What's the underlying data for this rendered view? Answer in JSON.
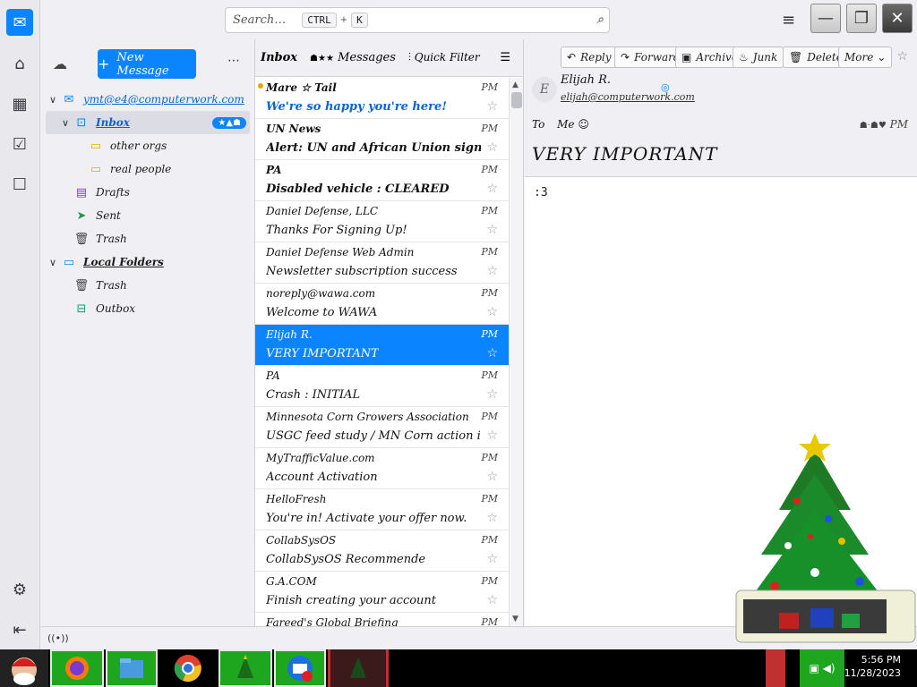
{
  "search": {
    "placeholder": "Search…",
    "kbd1": "CTRL",
    "kbd2": "K"
  },
  "folder_pane": {
    "new_message": "New Message",
    "account": "ymt@e4@computerwork.com",
    "badge": "",
    "folders": [
      {
        "label": "Inbox"
      },
      {
        "label": "other orgs"
      },
      {
        "label": "real people"
      },
      {
        "label": "Drafts"
      },
      {
        "label": "Sent"
      },
      {
        "label": "Trash"
      },
      {
        "label": "Local Folders"
      },
      {
        "label": "Trash"
      },
      {
        "label": "Outbox"
      }
    ]
  },
  "list": {
    "title": "Inbox",
    "count": "Messages",
    "quick_filter": "Quick Filter",
    "messages": [
      {
        "sender": "Mare ☆ Tail",
        "subject": "We're so happy you're here!",
        "time": "PM",
        "unread": true
      },
      {
        "sender": "UN News",
        "subject": "Alert: UN and African Union sign new hi...",
        "time": "PM",
        "unread": true
      },
      {
        "sender": "PA",
        "subject": "Disabled vehicle : CLEARED",
        "time": "PM",
        "unread": true
      },
      {
        "sender": "Daniel Defense, LLC",
        "subject": "Thanks For Signing Up!",
        "time": "PM",
        "unread": false
      },
      {
        "sender": "Daniel Defense Web Admin",
        "subject": "Newsletter subscription success",
        "time": "PM",
        "unread": false
      },
      {
        "sender": "noreply@wawa.com",
        "subject": "Welcome to WAWA",
        "time": "PM",
        "unread": false
      },
      {
        "sender": "Elijah R.",
        "subject": "VERY IMPORTANT",
        "time": "PM",
        "unread": false,
        "selected": true
      },
      {
        "sender": "PA",
        "subject": "Crash : INITIAL",
        "time": "PM",
        "unread": false
      },
      {
        "sender": "Minnesota Corn Growers Association",
        "subject": "USGC feed study / MN Corn action items",
        "time": "PM",
        "unread": false
      },
      {
        "sender": "MyTrafficValue.com",
        "subject": "Account Activation",
        "time": "PM",
        "unread": false
      },
      {
        "sender": "HelloFresh",
        "subject": "You're in! Activate your offer now.",
        "time": "PM",
        "unread": false
      },
      {
        "sender": "CollabSysOS",
        "subject": "CollabSysOS Recommende",
        "time": "PM",
        "unread": false
      },
      {
        "sender": "G.A.COM",
        "subject": "Finish creating your account",
        "time": "PM",
        "unread": false
      },
      {
        "sender": "Fareed's Global Briefing",
        "subject": "",
        "time": "PM",
        "unread": false
      }
    ]
  },
  "reader": {
    "actions": [
      "Reply",
      "Forward",
      "Archive",
      "Junk",
      "Delete",
      "More"
    ],
    "from_name": "Elijah R.",
    "from_addr": "elijah@computerwork.com",
    "to_label": "To",
    "to_value": "Me",
    "time": "PM",
    "subject": "VERY IMPORTANT",
    "body": ":3"
  },
  "taskbar": {
    "time": "5:56 PM",
    "date": "11/28/2023"
  },
  "colors": {
    "accent": "#0a84ff",
    "taskbar": "#000000",
    "task_green": "#1ea61e"
  }
}
